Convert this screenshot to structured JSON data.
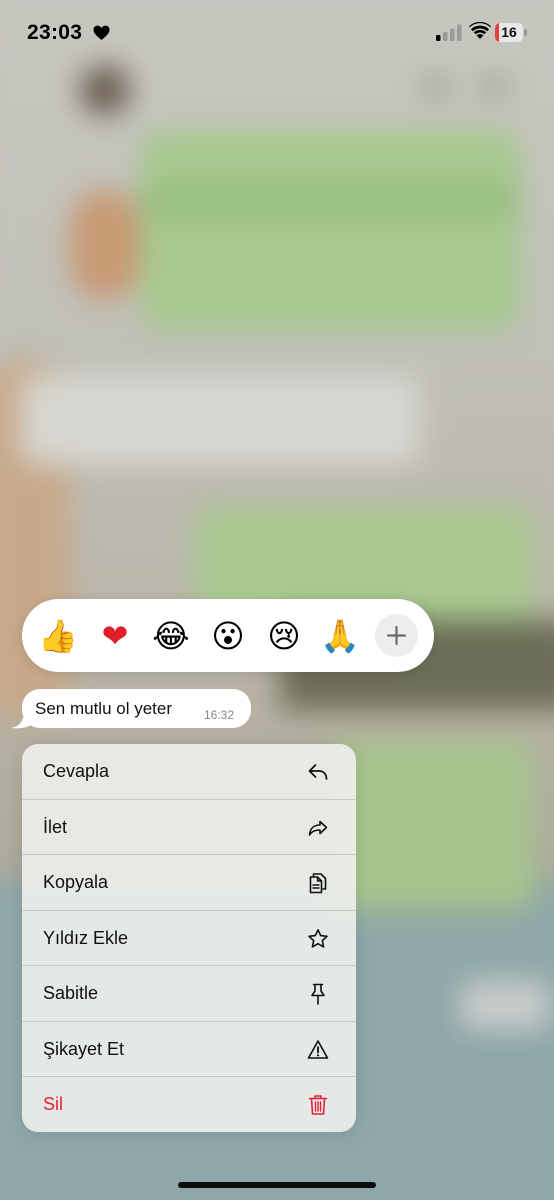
{
  "status_bar": {
    "time": "23:03",
    "battery_level": "16",
    "battery_fraction": 0.16,
    "icons": [
      "heart-icon",
      "cellular-signal-icon",
      "wifi-icon",
      "battery-icon"
    ]
  },
  "reactions": {
    "items": [
      {
        "name": "thumbs-up",
        "emoji": "👍"
      },
      {
        "name": "red-heart",
        "emoji": "❤"
      },
      {
        "name": "tears-of-joy",
        "emoji": "😂"
      },
      {
        "name": "surprised",
        "emoji": "😮"
      },
      {
        "name": "crying",
        "emoji": "😢"
      },
      {
        "name": "folded-hands",
        "emoji": "🙏"
      }
    ],
    "more_icon": "plus-icon"
  },
  "message": {
    "text": "Sen mutlu ol yeter",
    "time": "16:32"
  },
  "context_menu": {
    "items": [
      {
        "label": "Cevapla",
        "icon": "reply-arrow-icon"
      },
      {
        "label": "İlet",
        "icon": "forward-arrow-icon"
      },
      {
        "label": "Kopyala",
        "icon": "copy-icon"
      },
      {
        "label": "Yıldız Ekle",
        "icon": "star-icon"
      },
      {
        "label": "Sabitle",
        "icon": "pin-icon"
      },
      {
        "label": "Şikayet Et",
        "icon": "warning-icon"
      },
      {
        "label": "Sil",
        "icon": "trash-icon"
      }
    ],
    "destructive_color": "#e6203a"
  },
  "colors": {
    "menu_background": "#eceee9",
    "bubble_background": "#ffffff",
    "delete_red": "#e6203a"
  }
}
